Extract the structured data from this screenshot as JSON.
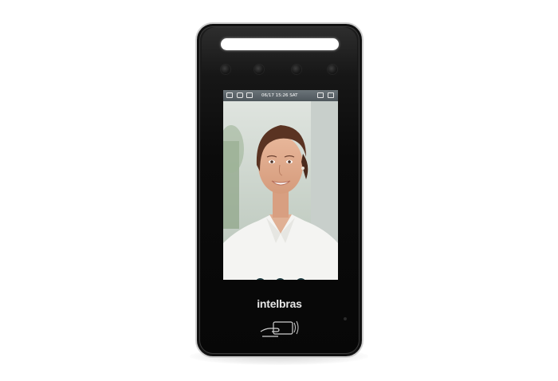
{
  "device": {
    "brand": "intelbras",
    "status_bar": {
      "datetime": "06/17 15:26 SAT",
      "icons": [
        "card-icon",
        "user-icon",
        "lock-icon",
        "door-icon",
        "wifi-icon"
      ]
    },
    "screen_buttons": [
      "menu-icon",
      "list-icon",
      "record-icon"
    ],
    "card_reader_icon": "contactless-card-icon"
  },
  "colors": {
    "body": "#0b0b0b",
    "bezel": "#cfcfcf",
    "light_bar": "#ffffff",
    "status_bar": "#55606a",
    "screen_button": "#1c3a3f"
  }
}
